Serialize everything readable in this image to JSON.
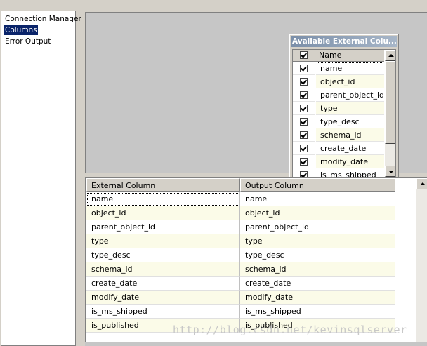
{
  "nav": {
    "items": [
      {
        "label": "Connection Manager",
        "selected": false
      },
      {
        "label": "Columns",
        "selected": true
      },
      {
        "label": "Error Output",
        "selected": false
      }
    ]
  },
  "external_columns": {
    "title": "Available External Colu...",
    "header_name": "Name",
    "rows": [
      {
        "name": "name",
        "checked": true
      },
      {
        "name": "object_id",
        "checked": true
      },
      {
        "name": "parent_object_id",
        "checked": true
      },
      {
        "name": "type",
        "checked": true
      },
      {
        "name": "type_desc",
        "checked": true
      },
      {
        "name": "schema_id",
        "checked": true
      },
      {
        "name": "create_date",
        "checked": true
      },
      {
        "name": "modify_date",
        "checked": true
      },
      {
        "name": "is_ms_shipped",
        "checked": true
      }
    ]
  },
  "mapping": {
    "headers": [
      "External Column",
      "Output Column"
    ],
    "rows": [
      [
        "name",
        "name"
      ],
      [
        "object_id",
        "object_id"
      ],
      [
        "parent_object_id",
        "parent_object_id"
      ],
      [
        "type",
        "type"
      ],
      [
        "type_desc",
        "type_desc"
      ],
      [
        "schema_id",
        "schema_id"
      ],
      [
        "create_date",
        "create_date"
      ],
      [
        "modify_date",
        "modify_date"
      ],
      [
        "is_ms_shipped",
        "is_ms_shipped"
      ],
      [
        "is_published",
        "is_published"
      ]
    ]
  },
  "watermark": "http://blog.csdn.net/kevinsqlserver",
  "colors": {
    "selection": "#0a246a",
    "alt_row": "#fbfbe8",
    "panel": "#c6c6c6",
    "face": "#d4d0c8"
  }
}
